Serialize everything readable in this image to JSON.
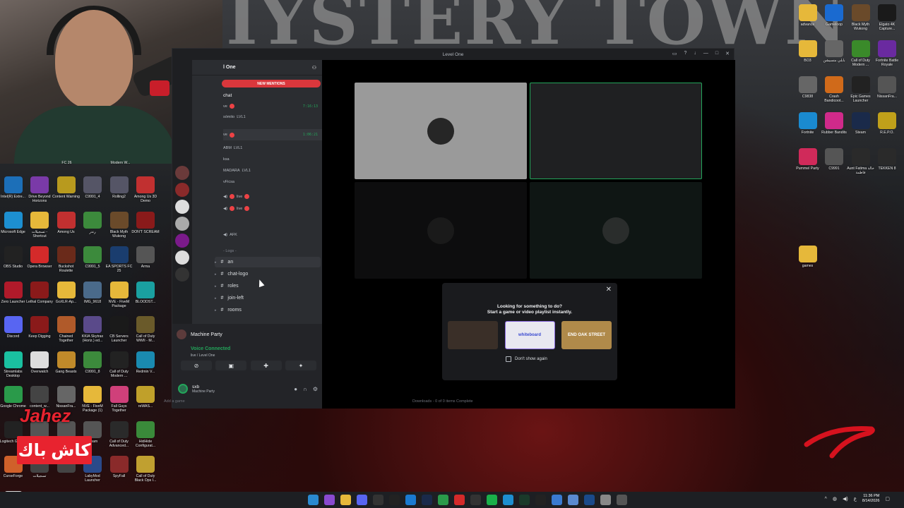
{
  "wallpaper": {
    "poster_title": "IYSTERY TOWN"
  },
  "desktop_left": [
    {
      "label": "FC 26",
      "icon": "fc-icon",
      "color": "#1a3d6e"
    },
    {
      "label": "Modern W...",
      "icon": "cod-icon",
      "color": "#444"
    },
    {
      "label": "Intel(R) Extre...",
      "icon": "intel-icon",
      "color": "#1c6fb8"
    },
    {
      "label": "Drive Beyond Horizons",
      "icon": "drive-icon",
      "color": "#7a3aa8"
    },
    {
      "label": "Content Warning",
      "icon": "warning-icon",
      "color": "#b89a1e"
    },
    {
      "label": "C9991_4",
      "icon": "image-icon",
      "color": "#556"
    },
    {
      "label": "Rolling2",
      "icon": "image-icon",
      "color": "#556"
    },
    {
      "label": "Among Us 3D Demo",
      "icon": "among-us-icon",
      "color": "#c13030"
    },
    {
      "label": "Microsoft Edge",
      "icon": "edge-icon",
      "color": "#1d8fd0"
    },
    {
      "label": "تسجيلات - Shortcut",
      "icon": "folder-icon",
      "color": "#e6b83a"
    },
    {
      "label": "Among Us",
      "icon": "among-us-icon",
      "color": "#c13030"
    },
    {
      "label": "رندر",
      "icon": "image-icon",
      "color": "#3c8a3c"
    },
    {
      "label": "Black Myth Wukong",
      "icon": "wukong-icon",
      "color": "#6a4a2a"
    },
    {
      "label": "DON'T SCREAM",
      "icon": "scream-icon",
      "color": "#8a1a1a"
    },
    {
      "label": "OBS Studio",
      "icon": "obs-icon",
      "color": "#222"
    },
    {
      "label": "Opera Browser",
      "icon": "opera-icon",
      "color": "#d42a2a"
    },
    {
      "label": "Buckshot Roulette",
      "icon": "buckshot-icon",
      "color": "#6a2a1a"
    },
    {
      "label": "C9991_5",
      "icon": "image-icon",
      "color": "#3c8a3c"
    },
    {
      "label": "EA SPORTS FC 25",
      "icon": "fc-icon",
      "color": "#1a3d6e"
    },
    {
      "label": "Arma",
      "icon": "arma-icon",
      "color": "#555"
    },
    {
      "label": "Zero Launcher",
      "icon": "zero-icon",
      "color": "#b01a2a"
    },
    {
      "label": "Lethal Company",
      "icon": "lethal-icon",
      "color": "#8a1a1a"
    },
    {
      "label": "GoXLR-Ap...",
      "icon": "folder-icon",
      "color": "#e6b83a"
    },
    {
      "label": "IMG_9618",
      "icon": "image-icon",
      "color": "#4a6a8a"
    },
    {
      "label": "NVE - FiveM Package",
      "icon": "folder-icon",
      "color": "#e6b83a"
    },
    {
      "label": "BLOODST...",
      "icon": "blood-icon",
      "color": "#1aa0a0"
    },
    {
      "label": "Discord",
      "icon": "discord-icon",
      "color": "#5865f2"
    },
    {
      "label": "Keep Digging",
      "icon": "dig-icon",
      "color": "#8a1a1a"
    },
    {
      "label": "Chained Together",
      "icon": "chain-icon",
      "color": "#b05a2a"
    },
    {
      "label": "KKIA Skytrax (Horiz.) ed...",
      "icon": "image-icon",
      "color": "#5a4a8a"
    },
    {
      "label": "CB Servers Launcher",
      "icon": "cb-icon",
      "color": "#1a1a1a"
    },
    {
      "label": "Call of Duty WWII - M...",
      "icon": "cod-icon",
      "color": "#6a5a2a"
    },
    {
      "label": "Streamlabs Desktop",
      "icon": "streamlabs-icon",
      "color": "#1ac0a0"
    },
    {
      "label": "Overwatch",
      "icon": "overwatch-icon",
      "color": "#ddd"
    },
    {
      "label": "Gang Beasts",
      "icon": "gang-icon",
      "color": "#c08a2a"
    },
    {
      "label": "C9991_8",
      "icon": "image-icon",
      "color": "#3c8a3c"
    },
    {
      "label": "Call of Duty Modern ...",
      "icon": "cod-icon",
      "color": "#222"
    },
    {
      "label": "Redmin V...",
      "icon": "redmin-icon",
      "color": "#1a8ab0"
    },
    {
      "label": "Google Chrome",
      "icon": "chrome-icon",
      "color": "#2a9a4a"
    },
    {
      "label": "content_w...",
      "icon": "image-icon",
      "color": "#444"
    },
    {
      "label": "NissanFra...",
      "icon": "image-icon",
      "color": "#666"
    },
    {
      "label": "NVE - FiveM Package (1)",
      "icon": "folder-icon",
      "color": "#e6b83a"
    },
    {
      "label": "Fall Guys Together",
      "icon": "fallguys-icon",
      "color": "#d0407a"
    },
    {
      "label": "reWAS...",
      "icon": "rewas-icon",
      "color": "#c0a02a"
    },
    {
      "label": "Logitech G HUB",
      "icon": "ghub-icon",
      "color": "#222"
    },
    {
      "label": "",
      "icon": "image-icon",
      "color": "#555"
    },
    {
      "label": "",
      "icon": "image-icon",
      "color": "#555"
    },
    {
      "label": "cream",
      "icon": "image-icon",
      "color": "#555"
    },
    {
      "label": "Call of Duty Advanced...",
      "icon": "cod-icon",
      "color": "#2a2a2a"
    },
    {
      "label": "HidHide Configurat...",
      "icon": "hidhide-icon",
      "color": "#3a8a3a"
    },
    {
      "label": "CurseForge",
      "icon": "curseforge-icon",
      "color": "#d0602a"
    },
    {
      "label": "تسجيلات",
      "icon": "image-icon",
      "color": "#444"
    },
    {
      "label": "",
      "icon": "image-icon",
      "color": "#444"
    },
    {
      "label": "LabyMod Launcher",
      "icon": "labymod-icon",
      "color": "#2a4a8a"
    },
    {
      "label": "SpyFall",
      "icon": "spyfall-icon",
      "color": "#8a2a2a"
    },
    {
      "label": "Call of Duty Black Ops I...",
      "icon": "cod-icon",
      "color": "#c0a030"
    },
    {
      "label": "MECCHA CHAMELE...",
      "icon": "meccha-icon",
      "color": "#ddd"
    }
  ],
  "desktop_right": [
    {
      "label": "advance",
      "icon": "folder-icon",
      "color": "#e6b83a"
    },
    {
      "label": "Gameloop",
      "icon": "gameloop-icon",
      "color": "#1a6ad0"
    },
    {
      "label": "Black Myth Wukong",
      "icon": "wukong-icon",
      "color": "#6a4a2a"
    },
    {
      "label": "Elgato 4K Capture...",
      "icon": "elgato-icon",
      "color": "#1a1a1a"
    },
    {
      "label": "BO3",
      "icon": "folder-icon",
      "color": "#e6b83a"
    },
    {
      "label": "بابلي منسيشن",
      "icon": "image-icon",
      "color": "#666"
    },
    {
      "label": "Call of Duty Modern ...",
      "icon": "cod-icon",
      "color": "#3a8a2a"
    },
    {
      "label": "Fortnite Battle Royale",
      "icon": "fortnite-icon",
      "color": "#6a2aa0"
    },
    {
      "label": "C9838",
      "icon": "image-icon",
      "color": "#666"
    },
    {
      "label": "Crash Bandicoot...",
      "icon": "crash-icon",
      "color": "#d06a1a"
    },
    {
      "label": "Epic Games Launcher",
      "icon": "epic-icon",
      "color": "#222"
    },
    {
      "label": "NissanFra...",
      "icon": "image-icon",
      "color": "#555"
    },
    {
      "label": "Fortnite",
      "icon": "fortnite-icon",
      "color": "#1a8ad0"
    },
    {
      "label": "Rubber Bandits",
      "icon": "rubber-icon",
      "color": "#d02a8a"
    },
    {
      "label": "Steam",
      "icon": "steam-icon",
      "color": "#1a2a4a"
    },
    {
      "label": "R.E.P.O.",
      "icon": "repo-icon",
      "color": "#c0a01a"
    },
    {
      "label": "Pummel Party",
      "icon": "pummel-icon",
      "color": "#d02a5a"
    },
    {
      "label": "C9991",
      "icon": "image-icon",
      "color": "#555"
    },
    {
      "label": "Aunt Fatima خالة فاطمة",
      "icon": "fatima-icon",
      "color": "#2a2a2a"
    },
    {
      "label": "TEKKEN 8",
      "icon": "tekken-icon",
      "color": "#2a2a2a"
    },
    {
      "label": "games",
      "icon": "folder-icon",
      "color": "#e6b83a"
    }
  ],
  "discord": {
    "window_title": "Level One",
    "server_name": "l One",
    "new_mentions": "NEW MENTIONS",
    "chat_channel": "chat",
    "stream_rows": [
      {
        "name": "ve",
        "time": "7:16:13"
      },
      {
        "name": "ve",
        "time": "1:06:21"
      }
    ],
    "voice_members": [
      {
        "name": "sómito",
        "badge": "LVL1"
      },
      {
        "name": "ABM",
        "badge": "LVL1"
      },
      {
        "name": "ksa",
        "badge": ""
      },
      {
        "name": "MADARA",
        "badge": "LVL1"
      },
      {
        "name": "vFicsa",
        "badge": ""
      }
    ],
    "live_labels": [
      "live",
      "live"
    ],
    "afk_channel": "AFK",
    "logs_category": "- Logs -",
    "text_channels": [
      "an",
      "chat-logo",
      "roles",
      "join-left",
      "rooms"
    ],
    "activity_name": "Machine Party",
    "voice_connected": "Voice Connected",
    "voice_sub": "live / Level One",
    "user_name": "sxb",
    "user_status": "Machine Party",
    "chat_placeholder": "Add a game",
    "downloads_status": "Downloads - 0 of 0 items Complete",
    "popup": {
      "line1": "Looking for something to do?",
      "line2": "Start a game or video playlist instantly.",
      "thumbs": [
        {
          "label": "",
          "color": "#3a2f28",
          "icon": "game-thumb-icon"
        },
        {
          "label": "whiteboard",
          "color": "#e8e8f0",
          "icon": "whiteboard-thumb-icon"
        },
        {
          "label": "END OAK STREET",
          "color": "#b08a4a",
          "icon": "oak-street-thumb-icon"
        }
      ],
      "dont_show": "Don't show again"
    }
  },
  "overlay": {
    "jahez": "Jahez",
    "cashback": "كاش باك"
  },
  "taskbar": {
    "apps": [
      "windows-icon",
      "copilot-icon",
      "folder-icon",
      "discord-icon",
      "terminal-icon",
      "obs-icon",
      "vscode-icon",
      "steam-icon",
      "chrome-icon",
      "opera-icon",
      "epic-icon",
      "spotify-icon",
      "edge-icon",
      "terminal-icon",
      "capcut-icon",
      "gallery-icon",
      "notepad-icon",
      "photoshop-icon",
      "settings-icon",
      "extra-icon"
    ],
    "lang": "ع",
    "time": "11:36 PM",
    "date": "8/14/2026"
  }
}
